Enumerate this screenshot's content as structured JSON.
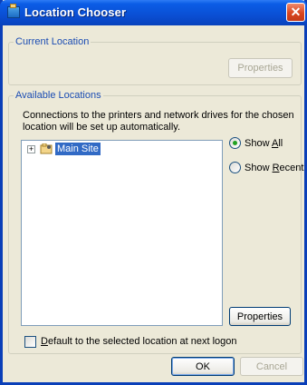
{
  "window": {
    "title": "Location Chooser",
    "close_glyph": "✕"
  },
  "current_location": {
    "legend": "Current Location",
    "properties_button": "Properties"
  },
  "available_locations": {
    "legend": "Available Locations",
    "description": "Connections to the printers and network drives for the chosen location will be set up automatically.",
    "tree": {
      "expander": "+",
      "item_label": "Main Site",
      "item_icon": "location-tree-icon"
    },
    "show_all": {
      "prefix": "Show ",
      "accel": "A",
      "suffix": "ll",
      "checked": true
    },
    "show_recent": {
      "prefix": "Show ",
      "accel": "R",
      "suffix": "ecent",
      "checked": false
    },
    "properties_button": "Properties"
  },
  "default_checkbox": {
    "accel": "D",
    "label_rest": "efault to the selected location at next logon",
    "checked": false
  },
  "footer": {
    "ok_button": "OK",
    "cancel_button": "Cancel"
  },
  "colors": {
    "titlebar": "#0A4FD4",
    "selection": "#316AC5",
    "legend_text": "#1A4CB3",
    "dialog_bg": "#ECE9D8"
  }
}
